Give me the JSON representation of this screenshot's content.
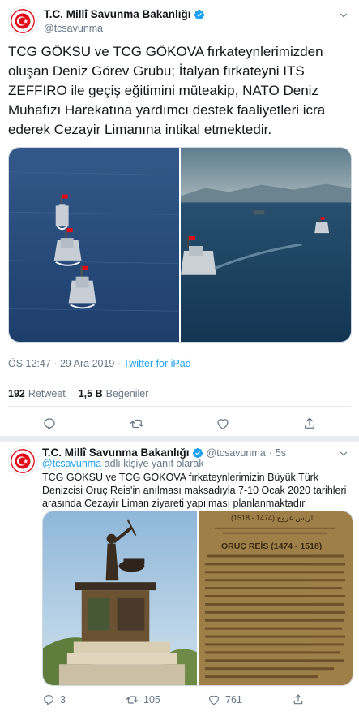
{
  "main_tweet": {
    "display_name": "T.C. Millî Savunma Bakanlığı",
    "handle": "@tcsavunma",
    "text": "TCG GÖKSU ve TCG GÖKOVA fırkateynlerimizden oluşan Deniz Görev Grubu; İtalyan fırkateyni ITS ZEFFIRO ile geçiş eğitimini müteakip, NATO Deniz Muhafızı Harekatına yardımcı destek faaliyetleri icra ederek Cezayir Limanına intikal etmektedir.",
    "time": "ÖS 12:47",
    "date": "29 Ara 2019",
    "separator": "·",
    "source": "Twitter for iPad",
    "retweets_count": "192",
    "retweets_label": "Retweet",
    "likes_count": "1,5 B",
    "likes_label": "Beğeniler"
  },
  "reply_tweet": {
    "display_name": "T.C. Millî Savunma Bakanlığı",
    "handle": "@tcsavunma",
    "separator": "·",
    "time_ago": "5s",
    "reply_mention": "@tcsavunma",
    "reply_context": "adlı kişiye yanıt olarak",
    "text": "TCG GÖKSU ve TCG GÖKOVA fırkateynlerimizin Büyük Türk Denizcisi Oruç Reis'in anılması maksadıyla 7-10 Ocak 2020 tarihleri arasında Cezayir Liman ziyareti yapılması planlanmaktadır.",
    "plaque_title": "ORUÇ REİS (1474 - 1518)",
    "plaque_arabic": "(1518 - 1474) الريس عروج",
    "reply_count": "3",
    "retweet_count": "105",
    "like_count": "761"
  },
  "icons": {
    "verified": "verified-badge-icon",
    "caret": "chevron-down-icon",
    "reply": "reply-icon",
    "retweet": "retweet-icon",
    "like": "heart-icon",
    "share": "share-icon"
  },
  "colors": {
    "link": "#1da1f2",
    "secondary_text": "#657786",
    "primary_text": "#14171a",
    "divider": "#e6ecf0",
    "logo_red": "#e30a17"
  }
}
